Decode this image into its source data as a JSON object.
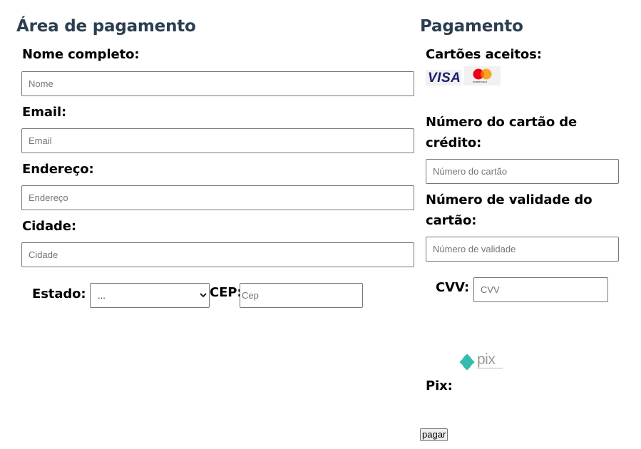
{
  "left": {
    "title": "Área de pagamento",
    "fields": {
      "name": {
        "label": "Nome completo:",
        "placeholder": "Nome"
      },
      "email": {
        "label": "Email:",
        "placeholder": "Email"
      },
      "address": {
        "label": "Endereço:",
        "placeholder": "Endereço"
      },
      "city": {
        "label": "Cidade:",
        "placeholder": "Cidade"
      },
      "state": {
        "label": "Estado:",
        "selected": "..."
      },
      "zip": {
        "label": "CEP:",
        "placeholder": "Cep"
      }
    }
  },
  "right": {
    "title": "Pagamento",
    "accepted_cards_label": "Cartões aceitos:",
    "visa_text": "VISA",
    "mastercard_text": "mastercard",
    "card_number": {
      "label_line1": "Número do cartão de",
      "label_line2": "crédito:",
      "placeholder": "Número do cartão"
    },
    "expiry": {
      "label_line1": "Número de validade do",
      "label_line2": "cartão:",
      "placeholder": "Número de validade"
    },
    "cvv": {
      "label": "CVV:",
      "placeholder": "CVV"
    },
    "pix_logo_text": "pix",
    "pix_label": "Pix:",
    "submit_label": "pagar"
  },
  "colors": {
    "heading": "#2c3e50",
    "visa_blue": "#1a1f71",
    "mc_red": "#eb001b",
    "mc_yellow": "#f79e1b",
    "pix_teal": "#32bcad"
  }
}
